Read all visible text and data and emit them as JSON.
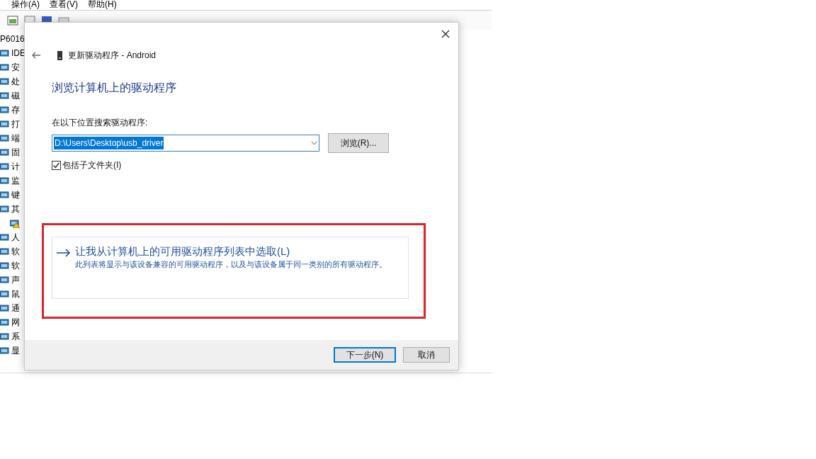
{
  "background_window": {
    "menu": [
      "操作(A)",
      "查看(V)",
      "帮助(H)"
    ],
    "tree": {
      "root": "P6016",
      "items": [
        {
          "label": "IDE"
        },
        {
          "label": "安"
        },
        {
          "label": "处"
        },
        {
          "label": "磁"
        },
        {
          "label": "存"
        },
        {
          "label": "打"
        },
        {
          "label": "端"
        },
        {
          "label": "固"
        },
        {
          "label": "计"
        },
        {
          "label": "监"
        },
        {
          "label": "键"
        },
        {
          "label": "其",
          "children": [
            {
              "warning": true
            }
          ]
        },
        {
          "label": "人"
        },
        {
          "label": "软"
        },
        {
          "label": "软"
        },
        {
          "label": "声"
        },
        {
          "label": "鼠"
        },
        {
          "label": "通"
        },
        {
          "label": "网"
        },
        {
          "label": "系"
        },
        {
          "label": "显"
        }
      ]
    }
  },
  "dialog": {
    "title": "更新驱动程序 - Android",
    "heading": "浏览计算机上的驱动程序",
    "search_label": "在以下位置搜索驱动程序:",
    "path_field": {
      "value": "D:\\Users\\Desktop\\usb_driver",
      "text_selected": true
    },
    "browse_button": "浏览(R)...",
    "include_subfolders": {
      "label": "包括子文件夹(I)",
      "checked": true
    },
    "option": {
      "title": "让我从计算机上的可用驱动程序列表中选取(L)",
      "description": "此列表将显示与该设备兼容的可用驱动程序，以及与该设备属于同一类别的所有驱动程序。",
      "highlighted": true
    },
    "buttons": [
      {
        "label": "下一步(N)",
        "focused": true
      },
      {
        "label": "取消",
        "focused": false
      }
    ]
  }
}
